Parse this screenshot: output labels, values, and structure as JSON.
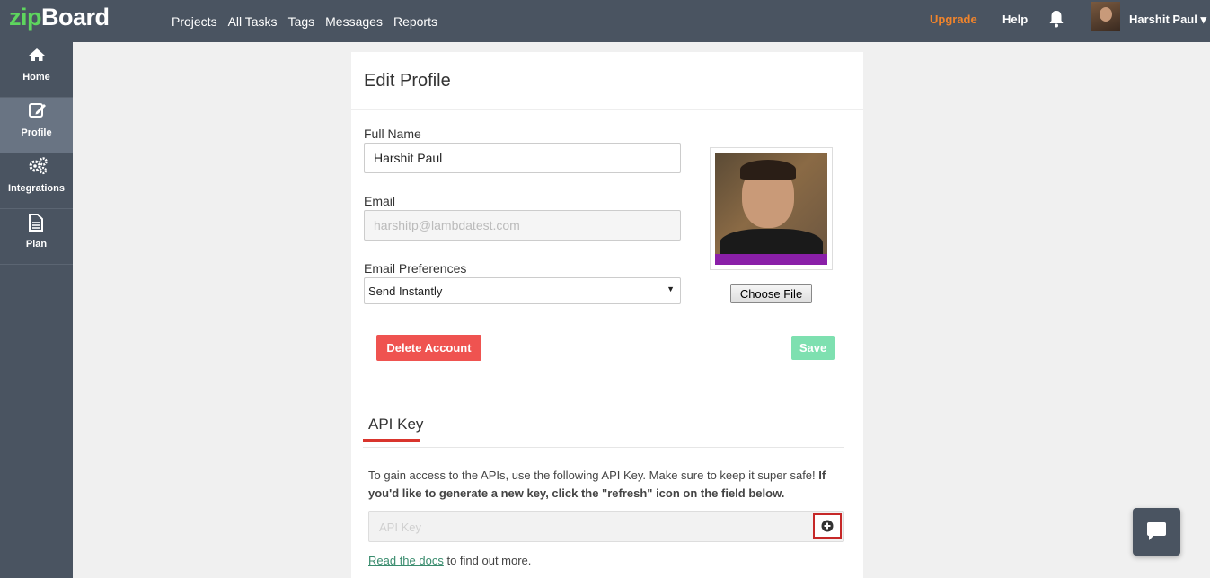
{
  "app": {
    "logo_part1": "zip",
    "logo_part2": "Board"
  },
  "topnav": {
    "items": [
      "Projects",
      "All Tasks",
      "Tags",
      "Messages",
      "Reports"
    ]
  },
  "header_right": {
    "upgrade": "Upgrade",
    "help": "Help",
    "bell_icon": "bell-icon",
    "user_name": "Harshit Paul",
    "user_caret": "▾"
  },
  "sidebar": {
    "items": [
      {
        "label": "Home",
        "icon": "home-icon"
      },
      {
        "label": "Profile",
        "icon": "edit-icon",
        "active": true
      },
      {
        "label": "Integrations",
        "icon": "gears-icon"
      },
      {
        "label": "Plan",
        "icon": "document-icon"
      }
    ]
  },
  "profile": {
    "title": "Edit Profile",
    "full_name_label": "Full Name",
    "full_name_value": "Harshit Paul",
    "email_label": "Email",
    "email_value": "harshitp@lambdatest.com",
    "email_pref_label": "Email Preferences",
    "email_pref_value": "Send Instantly",
    "choose_file": "Choose File",
    "delete_button": "Delete Account",
    "save_button": "Save"
  },
  "api": {
    "tab_label": "API Key",
    "desc_plain": "To gain access to the APIs, use the following API Key. Make sure to keep it super safe!",
    "desc_bold": "If you'd like to generate a new key, click the \"refresh\" icon on the field below.",
    "input_placeholder": "API Key",
    "docs_link": "Read the docs",
    "docs_suffix": " to find out more."
  },
  "colors": {
    "topbar": "#4a5461",
    "accent_upgrade": "#f0842c",
    "delete": "#ef5350",
    "save": "#7ee0b0",
    "api_underline": "#d9352d"
  }
}
